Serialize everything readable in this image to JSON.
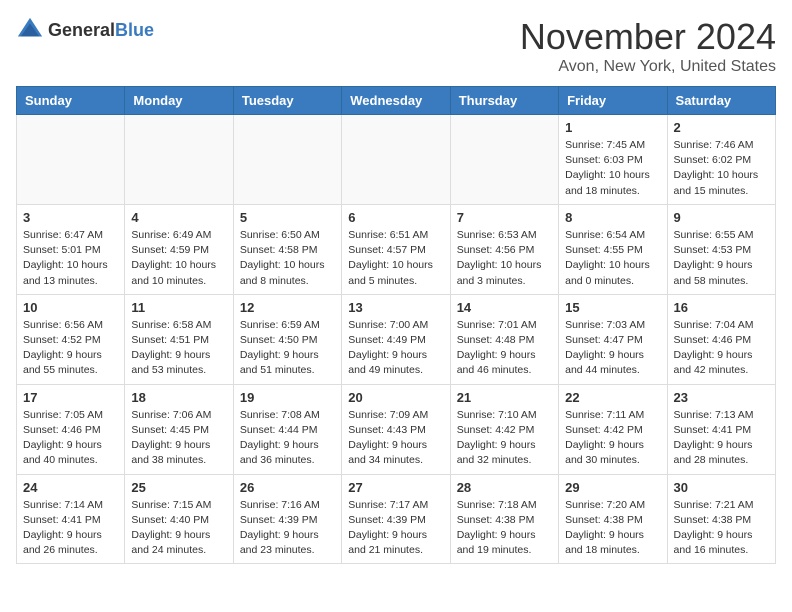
{
  "logo": {
    "general": "General",
    "blue": "Blue"
  },
  "header": {
    "month": "November 2024",
    "location": "Avon, New York, United States"
  },
  "weekdays": [
    "Sunday",
    "Monday",
    "Tuesday",
    "Wednesday",
    "Thursday",
    "Friday",
    "Saturday"
  ],
  "weeks": [
    [
      {
        "day": "",
        "info": ""
      },
      {
        "day": "",
        "info": ""
      },
      {
        "day": "",
        "info": ""
      },
      {
        "day": "",
        "info": ""
      },
      {
        "day": "",
        "info": ""
      },
      {
        "day": "1",
        "info": "Sunrise: 7:45 AM\nSunset: 6:03 PM\nDaylight: 10 hours\nand 18 minutes."
      },
      {
        "day": "2",
        "info": "Sunrise: 7:46 AM\nSunset: 6:02 PM\nDaylight: 10 hours\nand 15 minutes."
      }
    ],
    [
      {
        "day": "3",
        "info": "Sunrise: 6:47 AM\nSunset: 5:01 PM\nDaylight: 10 hours\nand 13 minutes."
      },
      {
        "day": "4",
        "info": "Sunrise: 6:49 AM\nSunset: 4:59 PM\nDaylight: 10 hours\nand 10 minutes."
      },
      {
        "day": "5",
        "info": "Sunrise: 6:50 AM\nSunset: 4:58 PM\nDaylight: 10 hours\nand 8 minutes."
      },
      {
        "day": "6",
        "info": "Sunrise: 6:51 AM\nSunset: 4:57 PM\nDaylight: 10 hours\nand 5 minutes."
      },
      {
        "day": "7",
        "info": "Sunrise: 6:53 AM\nSunset: 4:56 PM\nDaylight: 10 hours\nand 3 minutes."
      },
      {
        "day": "8",
        "info": "Sunrise: 6:54 AM\nSunset: 4:55 PM\nDaylight: 10 hours\nand 0 minutes."
      },
      {
        "day": "9",
        "info": "Sunrise: 6:55 AM\nSunset: 4:53 PM\nDaylight: 9 hours\nand 58 minutes."
      }
    ],
    [
      {
        "day": "10",
        "info": "Sunrise: 6:56 AM\nSunset: 4:52 PM\nDaylight: 9 hours\nand 55 minutes."
      },
      {
        "day": "11",
        "info": "Sunrise: 6:58 AM\nSunset: 4:51 PM\nDaylight: 9 hours\nand 53 minutes."
      },
      {
        "day": "12",
        "info": "Sunrise: 6:59 AM\nSunset: 4:50 PM\nDaylight: 9 hours\nand 51 minutes."
      },
      {
        "day": "13",
        "info": "Sunrise: 7:00 AM\nSunset: 4:49 PM\nDaylight: 9 hours\nand 49 minutes."
      },
      {
        "day": "14",
        "info": "Sunrise: 7:01 AM\nSunset: 4:48 PM\nDaylight: 9 hours\nand 46 minutes."
      },
      {
        "day": "15",
        "info": "Sunrise: 7:03 AM\nSunset: 4:47 PM\nDaylight: 9 hours\nand 44 minutes."
      },
      {
        "day": "16",
        "info": "Sunrise: 7:04 AM\nSunset: 4:46 PM\nDaylight: 9 hours\nand 42 minutes."
      }
    ],
    [
      {
        "day": "17",
        "info": "Sunrise: 7:05 AM\nSunset: 4:46 PM\nDaylight: 9 hours\nand 40 minutes."
      },
      {
        "day": "18",
        "info": "Sunrise: 7:06 AM\nSunset: 4:45 PM\nDaylight: 9 hours\nand 38 minutes."
      },
      {
        "day": "19",
        "info": "Sunrise: 7:08 AM\nSunset: 4:44 PM\nDaylight: 9 hours\nand 36 minutes."
      },
      {
        "day": "20",
        "info": "Sunrise: 7:09 AM\nSunset: 4:43 PM\nDaylight: 9 hours\nand 34 minutes."
      },
      {
        "day": "21",
        "info": "Sunrise: 7:10 AM\nSunset: 4:42 PM\nDaylight: 9 hours\nand 32 minutes."
      },
      {
        "day": "22",
        "info": "Sunrise: 7:11 AM\nSunset: 4:42 PM\nDaylight: 9 hours\nand 30 minutes."
      },
      {
        "day": "23",
        "info": "Sunrise: 7:13 AM\nSunset: 4:41 PM\nDaylight: 9 hours\nand 28 minutes."
      }
    ],
    [
      {
        "day": "24",
        "info": "Sunrise: 7:14 AM\nSunset: 4:41 PM\nDaylight: 9 hours\nand 26 minutes."
      },
      {
        "day": "25",
        "info": "Sunrise: 7:15 AM\nSunset: 4:40 PM\nDaylight: 9 hours\nand 24 minutes."
      },
      {
        "day": "26",
        "info": "Sunrise: 7:16 AM\nSunset: 4:39 PM\nDaylight: 9 hours\nand 23 minutes."
      },
      {
        "day": "27",
        "info": "Sunrise: 7:17 AM\nSunset: 4:39 PM\nDaylight: 9 hours\nand 21 minutes."
      },
      {
        "day": "28",
        "info": "Sunrise: 7:18 AM\nSunset: 4:38 PM\nDaylight: 9 hours\nand 19 minutes."
      },
      {
        "day": "29",
        "info": "Sunrise: 7:20 AM\nSunset: 4:38 PM\nDaylight: 9 hours\nand 18 minutes."
      },
      {
        "day": "30",
        "info": "Sunrise: 7:21 AM\nSunset: 4:38 PM\nDaylight: 9 hours\nand 16 minutes."
      }
    ]
  ]
}
